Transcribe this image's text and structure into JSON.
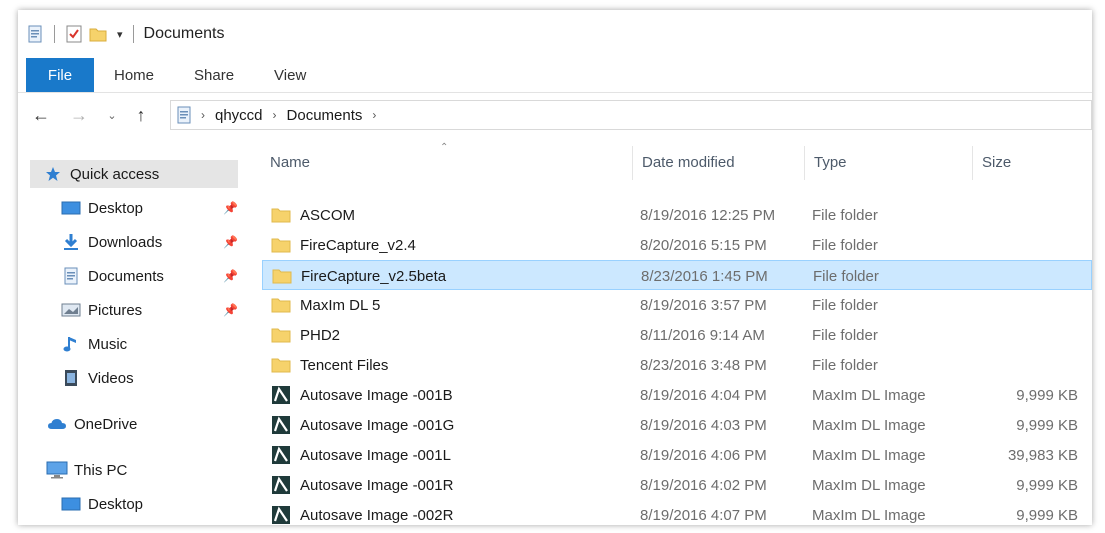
{
  "window": {
    "title": "Documents"
  },
  "ribbon": {
    "tabs": [
      "File",
      "Home",
      "Share",
      "View"
    ]
  },
  "address": {
    "crumbs": [
      "qhyccd",
      "Documents"
    ]
  },
  "nav": {
    "quick_access": "Quick access",
    "items": [
      {
        "label": "Desktop",
        "icon": "desktop-icon",
        "pinned": true
      },
      {
        "label": "Downloads",
        "icon": "download-icon",
        "pinned": true
      },
      {
        "label": "Documents",
        "icon": "documents-icon",
        "pinned": true
      },
      {
        "label": "Pictures",
        "icon": "pictures-icon",
        "pinned": true
      },
      {
        "label": "Music",
        "icon": "music-icon",
        "pinned": false
      },
      {
        "label": "Videos",
        "icon": "videos-icon",
        "pinned": false
      }
    ],
    "onedrive": "OneDrive",
    "thispc": "This PC",
    "thispc_desktop": "Desktop"
  },
  "files": {
    "columns": {
      "name": "Name",
      "date": "Date modified",
      "type": "Type",
      "size": "Size"
    },
    "rows": [
      {
        "name": "ASCOM",
        "date": "8/19/2016 12:25 PM",
        "type": "File folder",
        "size": "",
        "icon": "folder-icon"
      },
      {
        "name": "FireCapture_v2.4",
        "date": "8/20/2016 5:15 PM",
        "type": "File folder",
        "size": "",
        "icon": "folder-icon"
      },
      {
        "name": "FireCapture_v2.5beta",
        "date": "8/23/2016 1:45 PM",
        "type": "File folder",
        "size": "",
        "icon": "folder-icon"
      },
      {
        "name": "MaxIm DL 5",
        "date": "8/19/2016 3:57 PM",
        "type": "File folder",
        "size": "",
        "icon": "folder-icon"
      },
      {
        "name": "PHD2",
        "date": "8/11/2016 9:14 AM",
        "type": "File folder",
        "size": "",
        "icon": "folder-icon"
      },
      {
        "name": "Tencent Files",
        "date": "8/23/2016 3:48 PM",
        "type": "File folder",
        "size": "",
        "icon": "folder-icon"
      },
      {
        "name": "Autosave Image -001B",
        "date": "8/19/2016 4:04 PM",
        "type": "MaxIm DL Image",
        "size": "9,999 KB",
        "icon": "maxim-image-icon"
      },
      {
        "name": "Autosave Image -001G",
        "date": "8/19/2016 4:03 PM",
        "type": "MaxIm DL Image",
        "size": "9,999 KB",
        "icon": "maxim-image-icon"
      },
      {
        "name": "Autosave Image -001L",
        "date": "8/19/2016 4:06 PM",
        "type": "MaxIm DL Image",
        "size": "39,983 KB",
        "icon": "maxim-image-icon"
      },
      {
        "name": "Autosave Image -001R",
        "date": "8/19/2016 4:02 PM",
        "type": "MaxIm DL Image",
        "size": "9,999 KB",
        "icon": "maxim-image-icon"
      },
      {
        "name": "Autosave Image -002R",
        "date": "8/19/2016 4:07 PM",
        "type": "MaxIm DL Image",
        "size": "9,999 KB",
        "icon": "maxim-image-icon"
      }
    ],
    "selected_index": 2
  },
  "colors": {
    "file_tab": "#1979ca",
    "selection": "#cce8ff",
    "selection_border": "#99d1ff",
    "folder": "#f6d26b"
  }
}
